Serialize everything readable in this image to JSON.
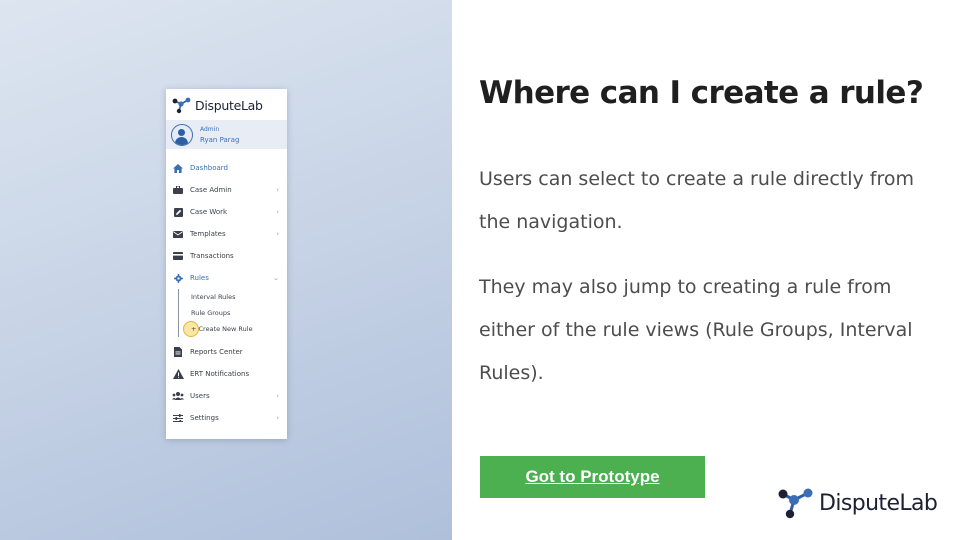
{
  "sidebar": {
    "logo_text": "DisputeLab",
    "user": {
      "role": "Admin",
      "name": "Ryan Parag"
    },
    "items": [
      {
        "label": "Dashboard",
        "icon": "home-icon",
        "chevron": false,
        "active": true
      },
      {
        "label": "Case Admin",
        "icon": "briefcase-icon",
        "chevron": true
      },
      {
        "label": "Case Work",
        "icon": "edit-icon",
        "chevron": true
      },
      {
        "label": "Templates",
        "icon": "envelope-icon",
        "chevron": true
      },
      {
        "label": "Transactions",
        "icon": "credit-card-icon",
        "chevron": false
      },
      {
        "label": "Rules",
        "icon": "gear-icon",
        "chevron": "down",
        "active": true
      },
      {
        "label": "Reports Center",
        "icon": "file-icon",
        "chevron": false
      },
      {
        "label": "ERT Notifications",
        "icon": "warning-icon",
        "chevron": false
      },
      {
        "label": "Users",
        "icon": "users-icon",
        "chevron": true
      },
      {
        "label": "Settings",
        "icon": "sliders-icon",
        "chevron": true
      }
    ],
    "rules_subitems": [
      {
        "label": "Interval Rules"
      },
      {
        "label": "Rule Groups"
      },
      {
        "label": "+ Create New Rule"
      }
    ]
  },
  "content": {
    "title": "Where can I create a rule?",
    "paragraph_1": "Users can select to create a rule directly from the navigation.",
    "paragraph_2": "They may also jump to creating a rule from either of the rule views (Rule Groups, Interval Rules).",
    "cta_label": "Got to Prototype"
  },
  "brand": {
    "text": "DisputeLab"
  },
  "colors": {
    "accent_blue": "#3a6fb5",
    "cta_green": "#4caf50",
    "title_text": "#1f1f1f",
    "body_text": "#4d4d4d",
    "highlight_yellow": "#f7d25a"
  }
}
